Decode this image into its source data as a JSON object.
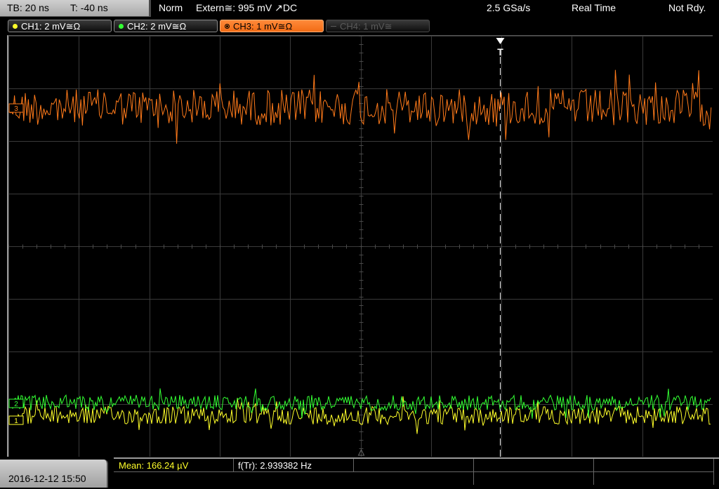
{
  "status_bar": {
    "timebase": "TB: 20 ns",
    "trigger_time": "T: -40 ns",
    "trigger_mode": "Norm",
    "trigger_source": "Extern≅: 995 mV ↗DC",
    "sample_rate": "2.5 GSa/s",
    "acq_mode": "Real Time",
    "status": "Not Rdy."
  },
  "channels": [
    {
      "label": "CH1: 2 mV≅Ω",
      "color": "#ffff2a",
      "active": true
    },
    {
      "label": "CH2: 2 mV≅Ω",
      "color": "#33ff33",
      "active": true
    },
    {
      "label": "CH3: 1 mV≅Ω",
      "color": "#ff7a1a",
      "active": true,
      "selected": true
    },
    {
      "label": "CH4: 1 mV≅",
      "color": "#5a5a5a",
      "active": false
    }
  ],
  "markers": {
    "trigger": "T",
    "ch1": "1",
    "ch2": "2",
    "ch3": "3"
  },
  "bottom": {
    "datetime": "2016-12-12 15:50",
    "measurements": [
      {
        "label": "Mean: 166.24 µV",
        "color": "#ffff2a"
      },
      {
        "label": "f(Tr): 2.939382 Hz",
        "color": "#ffffff"
      }
    ]
  },
  "colors": {
    "grid": "#3a3a3a",
    "trigger_line": "#ffffff",
    "background": "#000000"
  }
}
